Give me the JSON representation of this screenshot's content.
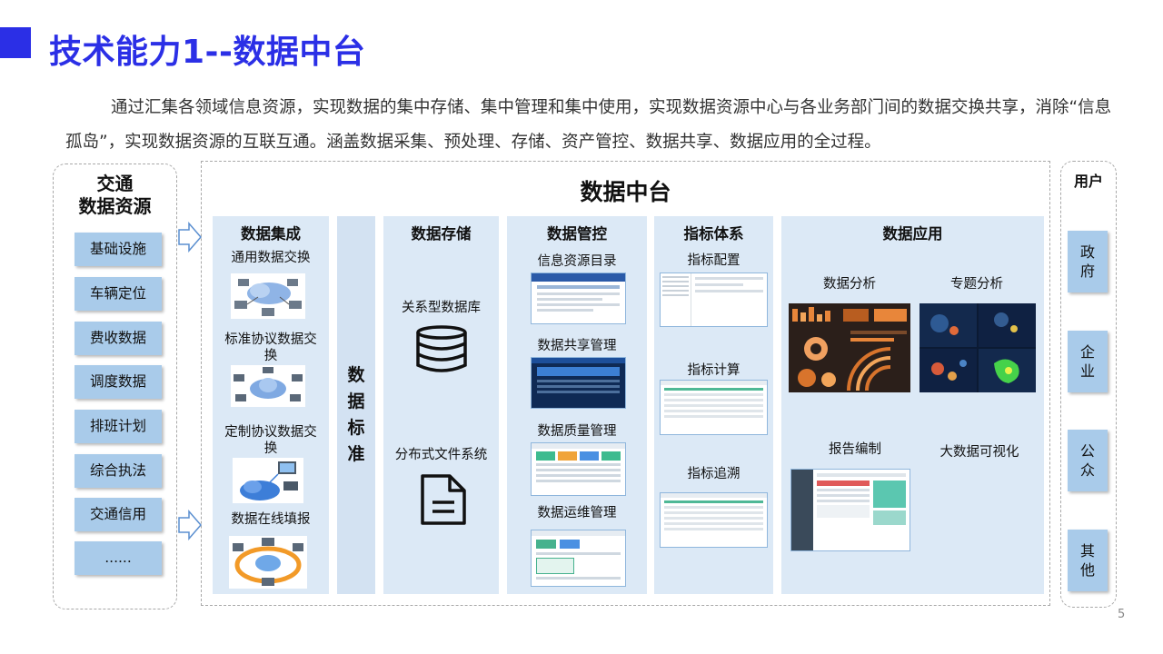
{
  "header": {
    "title": "技术能力1--数据中台"
  },
  "intro": "通过汇集各领域信息资源，实现数据的集中存储、集中管理和集中使用，实现数据资源中心与各业务部门间的数据交换共享，消除“信息孤岛”，实现数据资源的互联互通。涵盖数据采集、预处理、存储、资产管控、数据共享、数据应用的全过程。",
  "sources": {
    "title_line1": "交通",
    "title_line2": "数据资源",
    "items": [
      "基础设施",
      "车辆定位",
      "费收数据",
      "调度数据",
      "排班计划",
      "综合执法",
      "交通信用",
      "......"
    ]
  },
  "platform": {
    "title": "数据中台",
    "integration": {
      "title": "数据集成",
      "items": [
        "通用数据交换",
        "标准协议数据交换",
        "定制协议数据交换",
        "数据在线填报"
      ]
    },
    "standard": {
      "title": "数据标准"
    },
    "storage": {
      "title": "数据存储",
      "items": [
        "关系型数据库",
        "分布式文件系统"
      ]
    },
    "control": {
      "title": "数据管控",
      "items": [
        "信息资源目录",
        "数据共享管理",
        "数据质量管理",
        "数据运维管理"
      ]
    },
    "indicator": {
      "title": "指标体系",
      "items": [
        "指标配置",
        "指标计算",
        "指标追溯"
      ]
    },
    "application": {
      "title": "数据应用",
      "items": [
        "数据分析",
        "专题分析",
        "报告编制",
        "大数据可视化"
      ]
    }
  },
  "users": {
    "title": "用户",
    "items": [
      "政府",
      "企业",
      "公众",
      "其他"
    ]
  },
  "page_number": "5",
  "colors": {
    "accent": "#2b2fe6",
    "item_fill": "#a9cbea",
    "column_fill": "#dce9f6"
  }
}
